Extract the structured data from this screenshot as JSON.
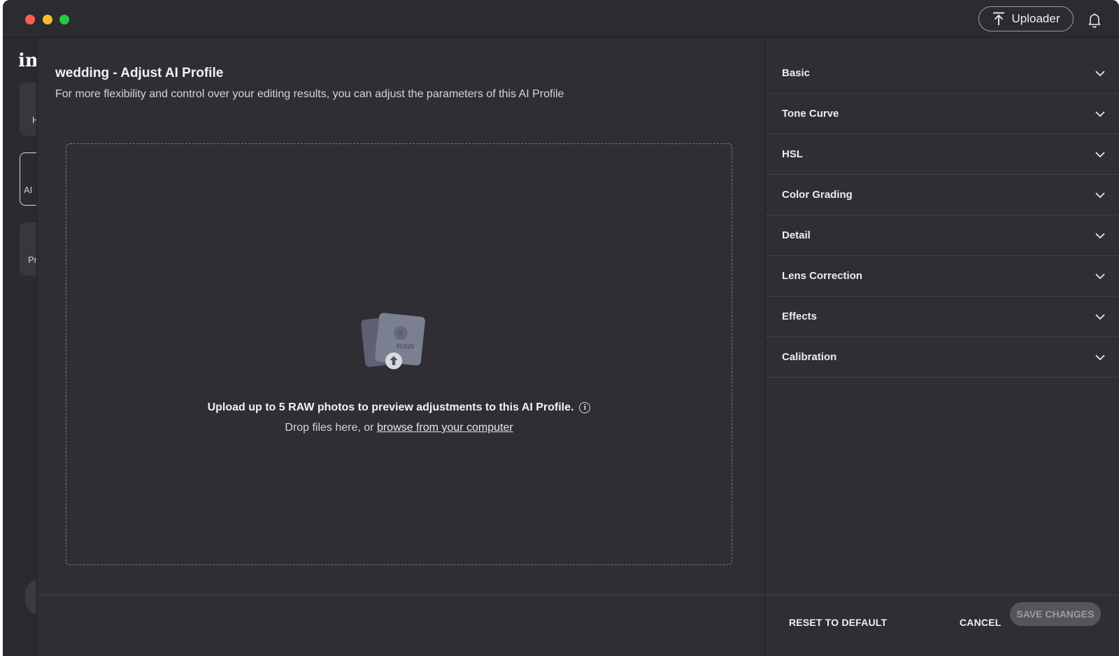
{
  "titlebar": {
    "uploader_label": "Uploader"
  },
  "background_app": {
    "logo_text": "im",
    "card1_text": "H",
    "card2_text": "AI",
    "card3_text": "Pr"
  },
  "main": {
    "title": "wedding - Adjust AI Profile",
    "description": "For more flexibility and control over your editing results, you can adjust the parameters of this AI Profile",
    "dropzone": {
      "art_label": "RAW",
      "headline": "Upload up to 5 RAW photos to preview adjustments to this AI Profile.",
      "info_glyph": "i",
      "sub_prefix": "Drop files here, or ",
      "sub_link": "browse from your computer"
    }
  },
  "panel": {
    "sections": [
      {
        "label": "Basic"
      },
      {
        "label": "Tone Curve"
      },
      {
        "label": "HSL"
      },
      {
        "label": "Color Grading"
      },
      {
        "label": "Detail"
      },
      {
        "label": "Lens Correction"
      },
      {
        "label": "Effects"
      },
      {
        "label": "Calibration"
      }
    ]
  },
  "footer": {
    "reset_label": "RESET TO DEFAULT",
    "cancel_label": "CANCEL",
    "save_label": "SAVE CHANGES"
  },
  "colors": {
    "background": "#2e2e33",
    "save_disabled": "#55555c"
  }
}
